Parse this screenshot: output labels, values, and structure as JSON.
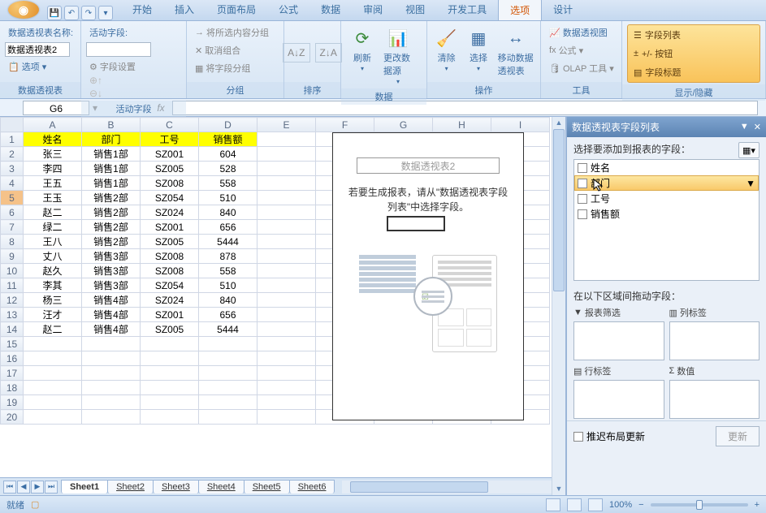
{
  "tabs": [
    "开始",
    "插入",
    "页面布局",
    "公式",
    "数据",
    "审阅",
    "视图",
    "开发工具",
    "选项",
    "设计"
  ],
  "active_tab": "选项",
  "ribbon": {
    "g1_lbl": "数据透视表",
    "pt_name_lbl": "数据透视表名称:",
    "pt_name_val": "数据透视表2",
    "opt_btn": "选项",
    "g2_lbl": "活动字段",
    "active_field_lbl": "活动字段:",
    "field_settings": "字段设置",
    "g3_lbl": "分组",
    "grp1": "将所选内容分组",
    "grp2": "取消组合",
    "grp3": "将字段分组",
    "g4_lbl": "排序",
    "g5_lbl": "数据",
    "refresh": "刷新",
    "change_src": "更改数据源",
    "g6_lbl": "操作",
    "clear": "清除",
    "select": "选择",
    "move": "移动数据透视表",
    "g7_lbl": "工具",
    "pivot_chart": "数据透视图",
    "formulas": "公式",
    "olap": "OLAP 工具",
    "g8_lbl": "显示/隐藏",
    "field_list": "字段列表",
    "pm_btns": "+/- 按钮",
    "field_hdrs": "字段标题"
  },
  "formula": {
    "name_box": "G6",
    "fx": "fx"
  },
  "cols": [
    "A",
    "B",
    "C",
    "D",
    "E",
    "F",
    "G",
    "H",
    "I"
  ],
  "headers": [
    "姓名",
    "部门",
    "工号",
    "销售额"
  ],
  "rows": [
    [
      "张三",
      "销售1部",
      "SZ001",
      "604"
    ],
    [
      "李四",
      "销售1部",
      "SZ005",
      "528"
    ],
    [
      "王五",
      "销售1部",
      "SZ008",
      "558"
    ],
    [
      "王玉",
      "销售2部",
      "SZ054",
      "510"
    ],
    [
      "赵二",
      "销售2部",
      "SZ024",
      "840"
    ],
    [
      "绿二",
      "销售2部",
      "SZ001",
      "656"
    ],
    [
      "王八",
      "销售2部",
      "SZ005",
      "5444"
    ],
    [
      "丈八",
      "销售3部",
      "SZ008",
      "878"
    ],
    [
      "赵久",
      "销售3部",
      "SZ008",
      "558"
    ],
    [
      "李其",
      "销售3部",
      "SZ054",
      "510"
    ],
    [
      "杨三",
      "销售4部",
      "SZ024",
      "840"
    ],
    [
      "汪才",
      "销售4部",
      "SZ001",
      "656"
    ],
    [
      "赵二",
      "销售4部",
      "SZ005",
      "5444"
    ]
  ],
  "selected_row": 5,
  "pivot": {
    "title": "数据透视表2",
    "msg": "若要生成报表，请从\"数据透视表字段列表\"中选择字段。"
  },
  "sheets": [
    "Sheet1",
    "Sheet2",
    "Sheet3",
    "Sheet4",
    "Sheet5",
    "Sheet6"
  ],
  "active_sheet": "Sheet1",
  "status": {
    "ready": "就绪",
    "zoom": "100%"
  },
  "field_pane": {
    "title": "数据透视表字段列表",
    "select_label": "选择要添加到报表的字段：",
    "fields": [
      "姓名",
      "部门",
      "工号",
      "销售额"
    ],
    "hover_field": "部门",
    "areas_label": "在以下区域间拖动字段：",
    "area1": "报表筛选",
    "area2": "列标签",
    "area3": "行标签",
    "area4": "数值",
    "defer": "推迟布局更新",
    "update": "更新"
  }
}
